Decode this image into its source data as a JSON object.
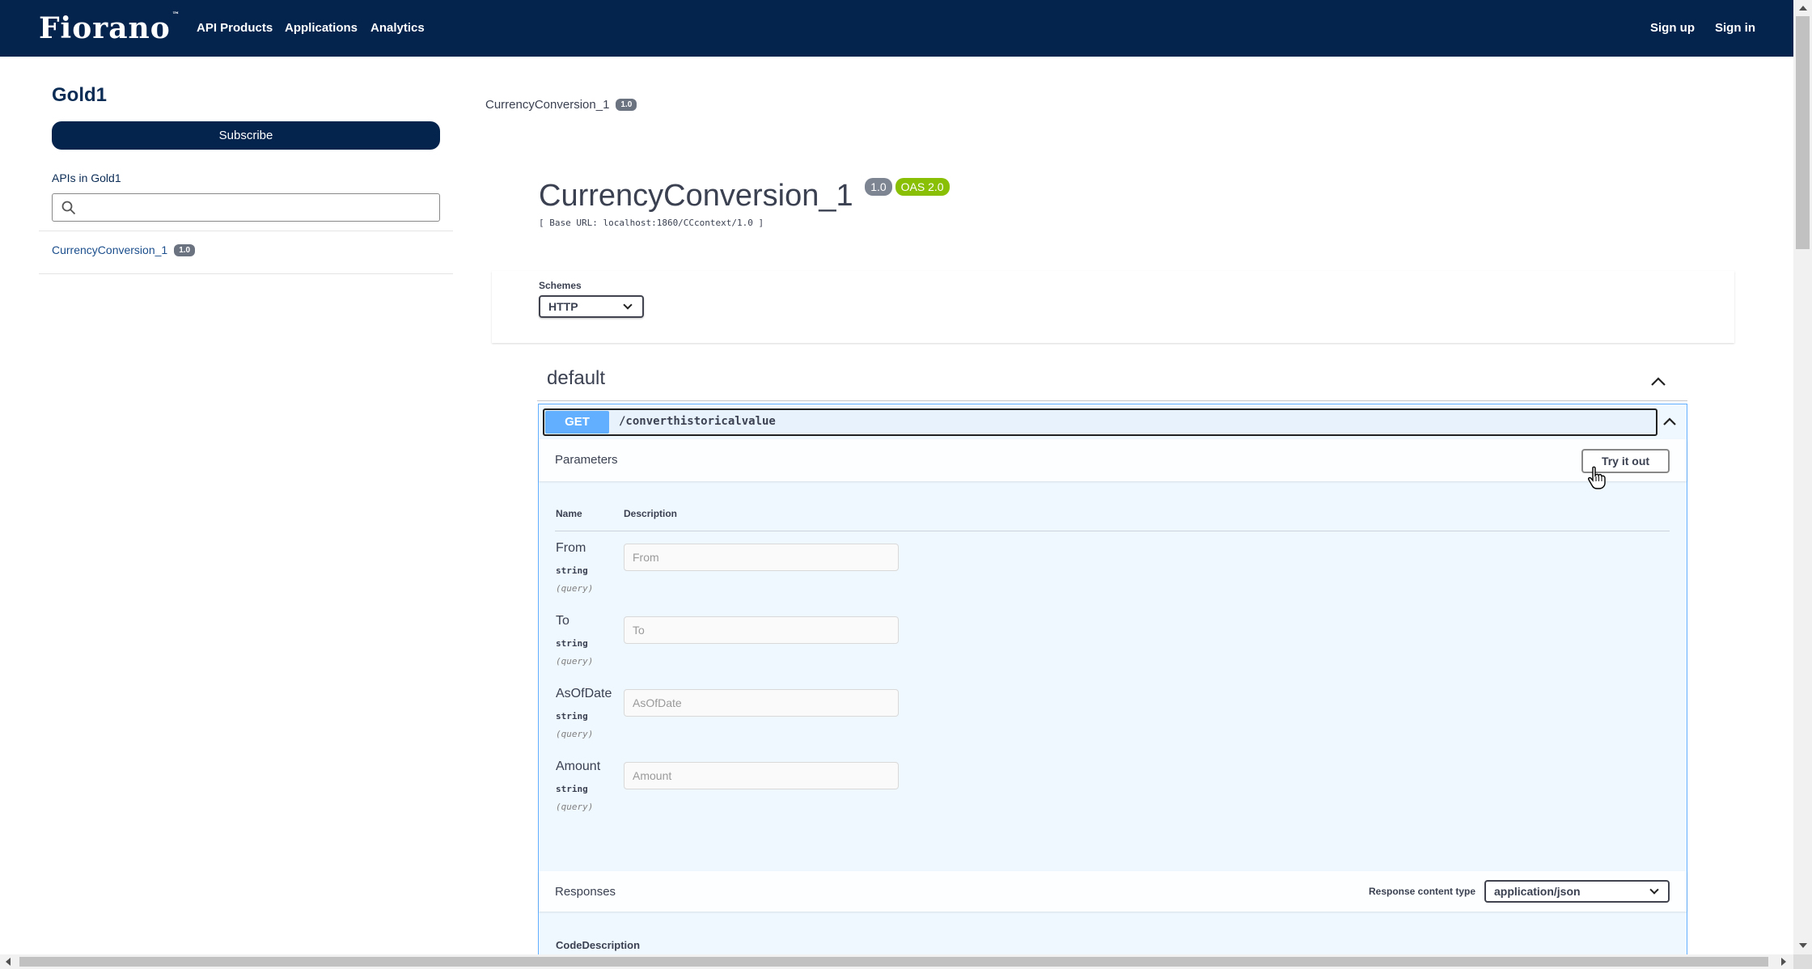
{
  "nav": {
    "logo": "Fiorano",
    "logo_mark": "™",
    "links": [
      "API Products",
      "Applications",
      "Analytics"
    ],
    "sign_up": "Sign up",
    "sign_in": "Sign in"
  },
  "sidebar": {
    "title": "Gold1",
    "subscribe": "Subscribe",
    "apis_label": "APIs in Gold1",
    "search_placeholder": "",
    "apis": [
      {
        "name": "CurrencyConversion_1",
        "version": "1.0"
      }
    ]
  },
  "breadcrumb": {
    "name": "CurrencyConversion_1",
    "version": "1.0"
  },
  "info": {
    "title": "CurrencyConversion_1",
    "version": "1.0",
    "oas": "OAS 2.0",
    "base_url": "[ Base URL: localhost:1860/CCcontext/1.0 ]"
  },
  "schemes": {
    "label": "Schemes",
    "selected": "HTTP"
  },
  "tag": {
    "name": "default"
  },
  "operation": {
    "method": "GET",
    "path": "/converthistoricalvalue",
    "parameters_label": "Parameters",
    "try_it_out": "Try it out",
    "col_name": "Name",
    "col_description": "Description",
    "params": [
      {
        "name": "From",
        "type": "string",
        "in": "(query)",
        "placeholder": "From"
      },
      {
        "name": "To",
        "type": "string",
        "in": "(query)",
        "placeholder": "To"
      },
      {
        "name": "AsOfDate",
        "type": "string",
        "in": "(query)",
        "placeholder": "AsOfDate"
      },
      {
        "name": "Amount",
        "type": "string",
        "in": "(query)",
        "placeholder": "Amount"
      }
    ],
    "responses_label": "Responses",
    "response_content_type_label": "Response content type",
    "response_content_type": "application/json",
    "col_code": "Code",
    "col_resp_description": "Description"
  },
  "colors": {
    "nav_bg": "#04234d",
    "get_blue": "#61affe",
    "oas_green": "#89bf04"
  }
}
